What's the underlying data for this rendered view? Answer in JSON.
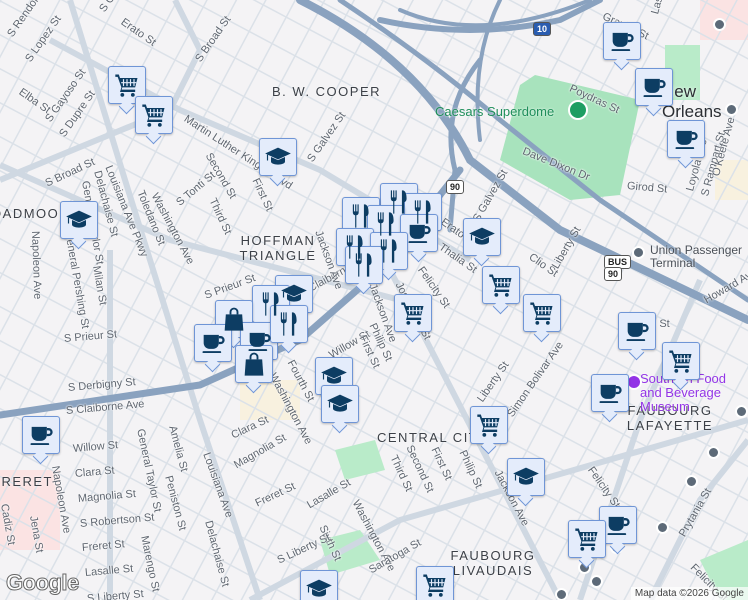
{
  "map": {
    "city_label": "New Orleans",
    "neighborhoods": {
      "bw_cooper": "B. W. COOPER",
      "hoffman": "HOFFMAN TRIANGLE",
      "broadmoor": "BROADMOOR",
      "central_city": "CENTRAL CITY",
      "faubourg_lafayette": "FAUBOURG LAFAYETTE",
      "faubourg_livaudais": "FAUBOURG LIVAUDAIS",
      "freret": "FRERET"
    },
    "places": {
      "superdome": "Caesars Superdome",
      "museum": "Southern Food and Beverage Museum",
      "union_terminal": "Union Passenger Terminal"
    },
    "streets": {
      "s_rendon": "S Rendon St",
      "s_lopez": "S Lopez St",
      "s_gayoso_top": "S Gayoso St",
      "erato_top": "Erato St",
      "s_broad_top": "S Broad St",
      "elba": "Elba St",
      "s_gayoso": "S Gayoso St",
      "s_dupre": "S Dupre St",
      "mlk": "Martin Luther King Jr Blvd",
      "s_galvez": "S Galvez St",
      "s_broad": "S Broad St",
      "gen_taylor_top": "General Taylor St",
      "louisiana_pkwy": "Louisiana Ave Pkwy",
      "delachaise_top": "Delachaise St",
      "toledano": "Toledano St",
      "washington_top": "Washington Ave",
      "s_tonti": "S Tonti St",
      "third_top": "Third St",
      "second_top": "Second St",
      "first_top": "First St",
      "fourth_top": "Fourth St",
      "napoleon_top": "Napoleon Ave",
      "gen_pershing": "General Pershing St",
      "milan": "Milan St",
      "s_prieur_top": "S Prieur St",
      "s_prieur": "S Prieur St",
      "s_derbigny": "S Derbigny St",
      "s_claiborne": "S Claiborne Ave",
      "claiborne_ne": "S Claiborne Ave",
      "willow": "Willow St",
      "clara": "Clara St",
      "magnolia": "Magnolia St",
      "s_robertson": "S Robertson St",
      "freret": "Freret St",
      "lasalle": "Lasalle St",
      "s_liberty": "S Liberty St",
      "napoleon": "Napoleon Ave",
      "cadiz": "Cadiz St",
      "jena": "Jena St",
      "gen_taylor": "General Taylor St",
      "amelia": "Amelia St",
      "peniston": "Peniston St",
      "marengo": "Marengo St",
      "louisiana": "Louisiana Ave",
      "delachaise": "Delachaise St",
      "clara_e": "Clara St",
      "magnolia_e": "Magnolia St",
      "washington": "Washington Ave",
      "fourth": "Fourth St",
      "freret_e": "Freret St",
      "lasalle_e": "Lasalle St",
      "sixth": "Sixth St",
      "s_liberty_e": "S Liberty St",
      "washington_s": "Washington Ave",
      "saratoga": "Saratoga St",
      "willow_e": "Willow St",
      "first": "First St",
      "philip": "Philip St",
      "jackson": "Jackson Ave",
      "josephine": "Josephine St",
      "felicity": "Felicity St",
      "erato": "Erato St",
      "thalia": "Thalia St",
      "clio": "Clio St",
      "liberty": "Liberty St",
      "simon_bolivar": "Simon Bolivar Ave",
      "liberty_s": "Liberty St",
      "third": "Third St",
      "second": "Second St",
      "first_s": "First St",
      "philip_s": "Philip St",
      "jackson_s": "Jackson Ave",
      "felicity_se": "Felicity St",
      "prytania": "Prytania St",
      "felicity_far": "Felicity St",
      "poydras": "Poydras St",
      "gravier": "Gravier St",
      "lasalle_n": "Lasalle St",
      "dave_dixon": "Dave Dixon Dr",
      "girod": "Girod St",
      "loyola": "Loyola Ave",
      "s_rampart": "S Rampart St",
      "okeefe": "O'Keefe Ave",
      "howard": "Howard Ave",
      "erato_e": "Erato St",
      "jackson_top": "Jackson Ave",
      "s_galvez_mid": "S Galvez St"
    },
    "shields": {
      "i10": "10",
      "us90": "90",
      "bus90": "90",
      "bus": "BUS"
    },
    "attribution": "Map data ©2026 Google",
    "google_logo": "Google"
  },
  "colors": {
    "marker_fill": "#e4ecfb",
    "marker_border": "#6f95d6",
    "icon": "#0d3d63",
    "highway": "#8aa2bf",
    "park": "#a8e3bd"
  }
}
